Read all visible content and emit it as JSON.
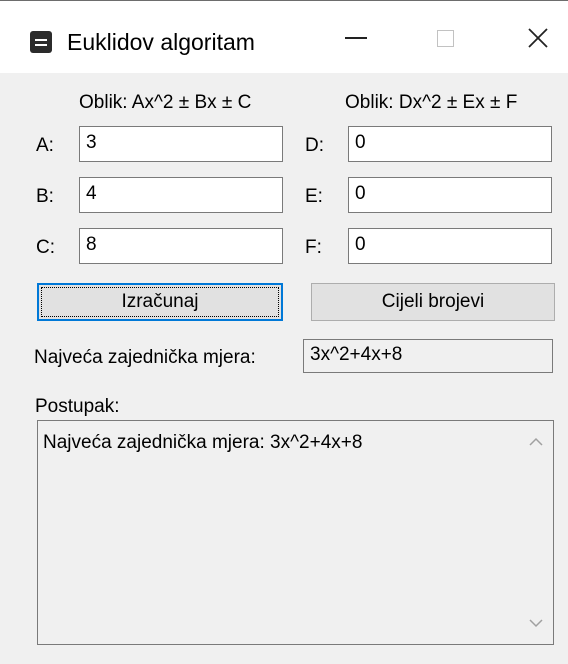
{
  "window": {
    "title": "Euklidov algoritam",
    "icon": "form-icon"
  },
  "form": {
    "hint_left": "Oblik: Ax^2 ± Bx ± C",
    "hint_right": "Oblik: Dx^2 ± Ex ± F",
    "fields": {
      "a": {
        "label": "A:",
        "value": "3"
      },
      "b": {
        "label": "B:",
        "value": "4"
      },
      "c": {
        "label": "C:",
        "value": "8"
      },
      "d": {
        "label": "D:",
        "value": "0"
      },
      "e": {
        "label": "E:",
        "value": "0"
      },
      "f": {
        "label": "F:",
        "value": "0"
      }
    }
  },
  "buttons": {
    "calculate": "Izračunaj",
    "integers": "Cijeli brojevi"
  },
  "result": {
    "label": "Najveća zajednička mjera:",
    "value": "3x^2+4x+8"
  },
  "procedure": {
    "label": "Postupak:",
    "text": "Najveća zajednička mjera: 3x^2+4x+8"
  },
  "colors": {
    "window_bg": "#f0f0f0",
    "accent": "#0078d7"
  }
}
